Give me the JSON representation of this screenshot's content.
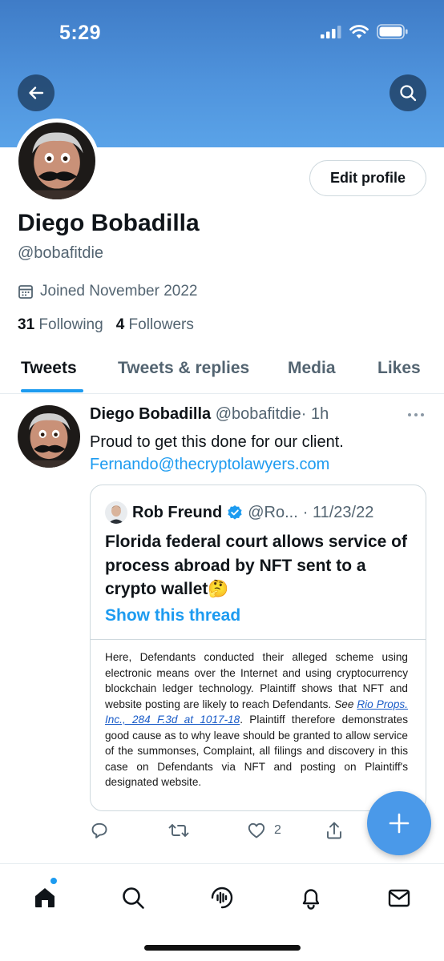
{
  "status_bar": {
    "time": "5:29"
  },
  "profile": {
    "display_name": "Diego Bobadilla",
    "handle": "@bobafitdie",
    "edit_label": "Edit profile",
    "joined": "Joined November 2022",
    "following_count": "31",
    "following_label": "Following",
    "followers_count": "4",
    "followers_label": "Followers"
  },
  "tabs": [
    {
      "label": "Tweets",
      "active": true
    },
    {
      "label": "Tweets & replies"
    },
    {
      "label": "Media"
    },
    {
      "label": "Likes"
    }
  ],
  "tweet": {
    "author_name": "Diego Bobadilla",
    "author_handle": "@bobafitdie",
    "time": "· 1h",
    "text": "Proud to get this done for our client.",
    "link": "Fernando@thecryptolawyers.com",
    "quote": {
      "author_name": "Rob Freund",
      "author_handle": "@Ro...",
      "date": "· 11/23/22",
      "text": "Florida federal court allows service of process abroad by NFT sent to a crypto wallet",
      "emoji": "🤔",
      "show_thread": "Show this thread",
      "excerpt_before": "Here, Defendants conducted their alleged scheme using electronic means over the Internet and using cryptocurrency blockchain ledger technology. Plaintiff shows that NFT and website posting are likely to reach Defendants.",
      "excerpt_see": "See",
      "excerpt_cite": "Rio Props. Inc., 284 F.3d at 1017-18",
      "excerpt_after": ". Plaintiff therefore demonstrates good cause as to why leave should be granted to allow service of the summonses, Complaint, all filings and discovery in this case on Defendants via NFT and posting on Plaintiff's designated website."
    },
    "likes_count": "2"
  },
  "colors": {
    "accent": "#1d9bf0",
    "banner": "#4f93dc",
    "fab": "#4a99e9"
  },
  "icons": [
    "back-arrow-icon",
    "search-icon",
    "calendar-icon",
    "more-icon",
    "reply-icon",
    "retweet-icon",
    "like-icon",
    "share-icon",
    "compose-plus-icon",
    "home-icon",
    "spaces-icon",
    "bell-icon",
    "mail-icon"
  ]
}
